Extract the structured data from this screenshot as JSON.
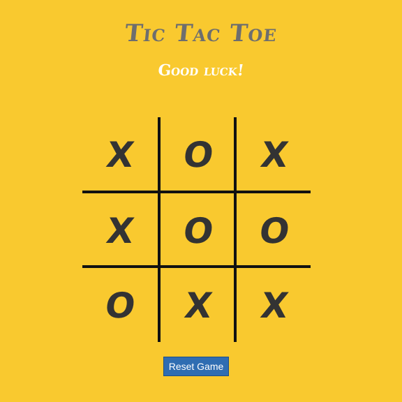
{
  "header": {
    "title": "Tic Tac Toe",
    "status": "Good luck!"
  },
  "board": {
    "cells": [
      "X",
      "O",
      "X",
      "X",
      "O",
      "O",
      "O",
      "X",
      "X"
    ]
  },
  "controls": {
    "reset_label": "Reset Game"
  },
  "colors": {
    "background": "#f9c92f",
    "title": "#6e6e6e",
    "status": "#ffffff",
    "mark": "#333333",
    "grid": "#111111",
    "button": "#2f6db2"
  }
}
